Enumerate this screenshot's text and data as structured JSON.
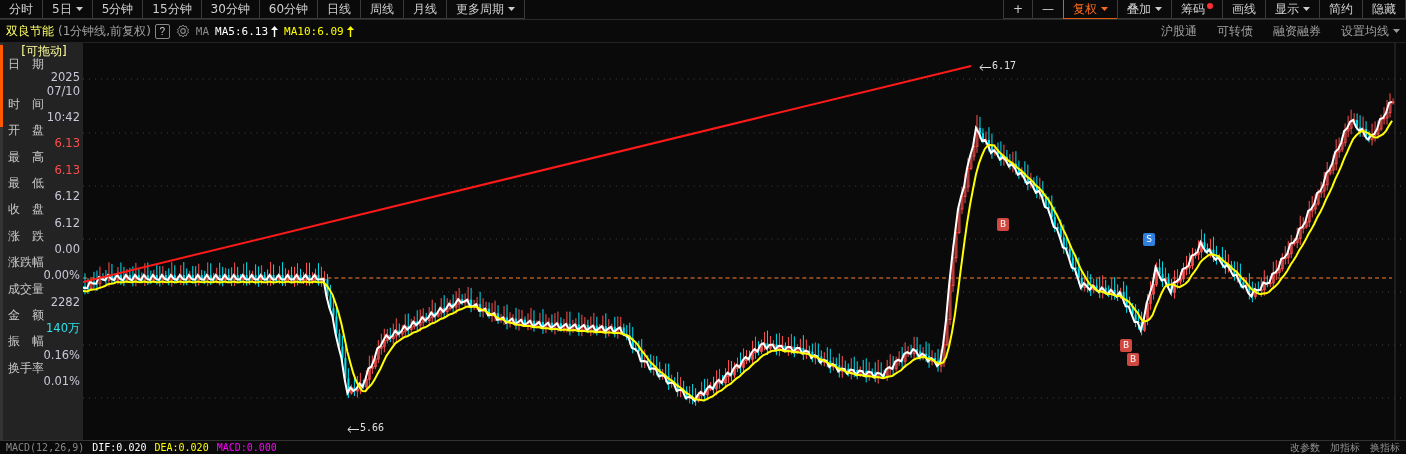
{
  "period_tabs": [
    {
      "label": "分时",
      "selected": false,
      "dropdown": false
    },
    {
      "label": "5日",
      "selected": false,
      "dropdown": true
    },
    {
      "label": "5分钟",
      "selected": false,
      "dropdown": false
    },
    {
      "label": "15分钟",
      "selected": false,
      "dropdown": false
    },
    {
      "label": "30分钟",
      "selected": false,
      "dropdown": false
    },
    {
      "label": "60分钟",
      "selected": false,
      "dropdown": false
    },
    {
      "label": "日线",
      "selected": false,
      "dropdown": false
    },
    {
      "label": "周线",
      "selected": false,
      "dropdown": false
    },
    {
      "label": "月线",
      "selected": false,
      "dropdown": false
    },
    {
      "label": "更多周期",
      "selected": false,
      "dropdown": true
    }
  ],
  "tools": [
    {
      "label": "+",
      "selected": false,
      "dropdown": false,
      "dot": false
    },
    {
      "label": "—",
      "selected": false,
      "dropdown": false,
      "dot": false
    },
    {
      "label": "复权",
      "selected": true,
      "dropdown": true,
      "dot": false
    },
    {
      "label": "叠加",
      "selected": false,
      "dropdown": true,
      "dot": false
    },
    {
      "label": "筹码",
      "selected": false,
      "dropdown": false,
      "dot": true
    },
    {
      "label": "画线",
      "selected": false,
      "dropdown": false,
      "dot": false
    },
    {
      "label": "显示",
      "selected": false,
      "dropdown": true,
      "dot": false
    },
    {
      "label": "简约",
      "selected": false,
      "dropdown": false,
      "dot": false
    },
    {
      "label": "隐藏",
      "selected": false,
      "dropdown": false,
      "dot": false
    }
  ],
  "header": {
    "stock_name": "双良节能",
    "period_note": "(1分钟线,前复权)",
    "help": "?",
    "indicator": "MA",
    "ma": [
      {
        "text": "MA5:6.13",
        "color": "#ffffff"
      },
      {
        "text": "MA10:6.09",
        "color": "#ffff00"
      }
    ],
    "links": [
      {
        "label": "沪股通",
        "dropdown": false
      },
      {
        "label": "可转债",
        "dropdown": false
      },
      {
        "label": "融资融券",
        "dropdown": false
      },
      {
        "label": "设置均线",
        "dropdown": true
      }
    ]
  },
  "info_panel": {
    "title": "[可拖动]",
    "items": [
      {
        "label": "日　期",
        "values": [
          "2025",
          "07/10"
        ],
        "color": "#c8c8d8"
      },
      {
        "label": "时　间",
        "values": [
          "10:42"
        ],
        "color": "#c8c8d8"
      },
      {
        "label": "开　盘",
        "values": [
          "6.13"
        ],
        "color": "#ff4c4c"
      },
      {
        "label": "最　高",
        "values": [
          "6.13"
        ],
        "color": "#ff4c4c"
      },
      {
        "label": "最　低",
        "values": [
          "6.12"
        ],
        "color": "#c8c8d8"
      },
      {
        "label": "收　盘",
        "values": [
          "6.12"
        ],
        "color": "#c8c8d8"
      },
      {
        "label": "涨　跌",
        "values": [
          "0.00"
        ],
        "color": "#c8c8d8"
      },
      {
        "label": "涨跌幅",
        "values": [
          "0.00%"
        ],
        "color": "#c8c8d8"
      },
      {
        "label": "成交量",
        "values": [
          "2282"
        ],
        "color": "#c8c8d8"
      },
      {
        "label": "金　额",
        "values": [
          "140万"
        ],
        "color": "#33e0e8"
      },
      {
        "label": "振　幅",
        "values": [
          "0.16%"
        ],
        "color": "#c8c8d8"
      },
      {
        "label": "换手率",
        "values": [
          "0.01%"
        ],
        "color": "#c8c8d8"
      }
    ]
  },
  "chart": {
    "high_label": "6.17",
    "low_label": "5.66",
    "markers": [
      {
        "kind": "buy",
        "text": "B"
      },
      {
        "kind": "buy",
        "text": "B"
      },
      {
        "kind": "buy",
        "text": "B"
      },
      {
        "kind": "sell",
        "text": "S"
      }
    ]
  },
  "indicator_bar": {
    "name": "MACD(12,26,9)",
    "values": [
      {
        "text": "DIF:0.020",
        "color": "#ffffff"
      },
      {
        "text": "DEA:0.020",
        "color": "#ffff00"
      },
      {
        "text": "MACD:0.000",
        "color": "#ff00ff"
      }
    ],
    "actions": [
      "改参数",
      "加指标",
      "换指标"
    ]
  }
}
